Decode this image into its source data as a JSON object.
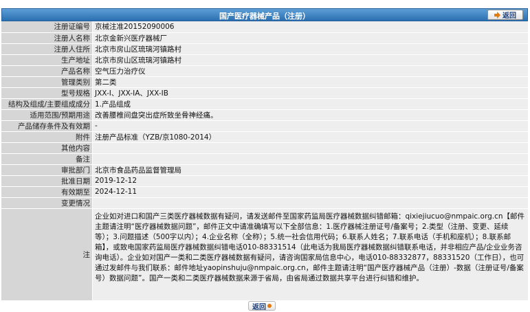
{
  "header": {
    "title": "国产医疗器械产品（注册）",
    "back_label": "返回"
  },
  "rows": [
    {
      "label": "注册证编号",
      "value": "京械注准20152090006"
    },
    {
      "label": "注册人名称",
      "value": "北京金新兴医疗器械厂"
    },
    {
      "label": "注册人住所",
      "value": "北京市房山区琉璃河镇路村"
    },
    {
      "label": "生产地址",
      "value": "北京市房山区琉璃河镇路村"
    },
    {
      "label": "产品名称",
      "value": "空气压力治疗仪"
    },
    {
      "label": "管理类别",
      "value": "第二类"
    },
    {
      "label": "型号规格",
      "value": "JXX-I、JXX-IA、JXX-IB"
    },
    {
      "label": "结构及组成/主要组成成分",
      "value": "1.产品组成"
    },
    {
      "label": "适用范围/预期用途",
      "value": "改善腰椎间盘突出症所致坐骨神经痛。"
    },
    {
      "label": "产品储存条件及有效期",
      "value": "-"
    },
    {
      "label": "附件",
      "value": "注册产品标准（YZB/京1080-2014）"
    },
    {
      "label": "其他内容",
      "value": ""
    },
    {
      "label": "备注",
      "value": ""
    },
    {
      "label": "审批部门",
      "value": "北京市食品药品监督管理局"
    },
    {
      "label": "批准日期",
      "value": "2019-12-12"
    },
    {
      "label": "有效期至",
      "value": "2024-12-11"
    },
    {
      "label": "变更情况",
      "value": ""
    }
  ],
  "note": {
    "label": "注",
    "text": "企业如对进口和国产三类医疗器械数据有疑问，请发送邮件至国家药监局医疗器械数据纠错邮箱：qixiejiucuo@nmpaic.org.cn【邮件主题请注明“医疗器械数据问题”，邮件正文中请准确填写以下全部信息：1.医疗器械注册证号/备案号；2.类型（注册、变更、延续等）；3.问题描述（500字以内）；4.企业名称（全称）；5.统一社会信用代码；6.联系人姓名；7.联系电话（手机和座机）；8.联系邮箱】，或致电国家药监局医疗器械数据纠错电话010-88331514（此电话为我局医疗器械数据纠错联系电话，并非相应产品/企业业务咨询电话）。企业如对国产一类和二类医疗器械数据有疑问，请咨询国家局信息中心，电话010-88332877，88331520（工作日），也可通过发邮件与我们联系：邮件地址yaopinshuju@nmpaic.org.cn，邮件主题请注明“国产医疗器械产品（注册）-数据（注册证号/备案号）数据问题”。国产一类和二类医疗器械数据来源于省局，由省局通过数据共享平台进行纠错和维护。"
  },
  "footer": {
    "back_label": "返回"
  },
  "colors": {
    "header_top": "#5e9fd6",
    "header_bottom": "#2a6fb1",
    "label_bg": "#d6d6d6",
    "value_bg": "#eeeeee",
    "accent": "#e27a12"
  }
}
